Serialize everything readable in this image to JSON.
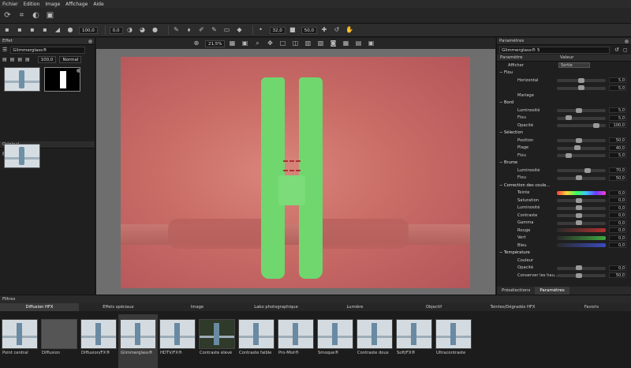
{
  "menu": [
    "Fichier",
    "Edition",
    "Image",
    "Affichage",
    "Aide"
  ],
  "toolbar2": {
    "value_1": "100,0",
    "value_2": "0,0",
    "value_3": "32,0",
    "value_4": "50,0"
  },
  "canvas": {
    "zoom": "21,5"
  },
  "effects_panel": {
    "title": "Effet",
    "preset_name": "Glimmerglass®",
    "opacity_value": "100,0",
    "mode_label": "Normal",
    "original_title": "Original"
  },
  "params_panel": {
    "title": "Paramètres",
    "preset_name": "Glimmerglass® 5",
    "col_param": "Paramètre",
    "col_value": "Valeur",
    "afficher_label": "Afficher",
    "afficher_value": "Sortie",
    "rows": [
      {
        "kind": "section",
        "label": "Flou"
      },
      {
        "kind": "item",
        "label": "Horizontal",
        "value": "5,0",
        "knob": 0.5
      },
      {
        "kind": "item",
        "label": "",
        "value": "5,0",
        "knob": 0.5
      },
      {
        "kind": "item",
        "label": "Mariage",
        "value": "",
        "knob": -1
      },
      {
        "kind": "section",
        "label": "Bord"
      },
      {
        "kind": "item",
        "label": "Luminosité",
        "value": "5,0",
        "knob": 0.45
      },
      {
        "kind": "item",
        "label": "Flou",
        "value": "5,0",
        "knob": 0.2
      },
      {
        "kind": "item",
        "label": "Opacité",
        "value": "100,0",
        "knob": 0.85
      },
      {
        "kind": "section",
        "label": "Sélection"
      },
      {
        "kind": "item",
        "label": "Position",
        "value": "50,0",
        "knob": 0.45
      },
      {
        "kind": "item",
        "label": "Plage",
        "value": "40,0",
        "knob": 0.4
      },
      {
        "kind": "item",
        "label": "Flou",
        "value": "5,0",
        "knob": 0.2
      },
      {
        "kind": "section",
        "label": "Brume"
      },
      {
        "kind": "item",
        "label": "Luminosité",
        "value": "70,0",
        "knob": 0.65
      },
      {
        "kind": "item",
        "label": "Flou",
        "value": "50,0",
        "knob": 0.45
      },
      {
        "kind": "section",
        "label": "Correction des coule..."
      },
      {
        "kind": "grad",
        "label": "Teinte",
        "value": "0,0",
        "colors": "linear-gradient(90deg,#ff3b3b,#ffd33b,#3bff5a,#3bc7ff,#6a3bff,#ff3bd0)"
      },
      {
        "kind": "item",
        "label": "Saturation",
        "value": "0,0",
        "knob": 0.45
      },
      {
        "kind": "item",
        "label": "Luminosité",
        "value": "0,0",
        "knob": 0.45
      },
      {
        "kind": "item",
        "label": "Contraste",
        "value": "0,0",
        "knob": 0.45
      },
      {
        "kind": "item",
        "label": "Gamma",
        "value": "0,0",
        "knob": 0.45
      },
      {
        "kind": "grad",
        "label": "Rouge",
        "value": "0,0",
        "colors": "linear-gradient(90deg,#2a2a2a,#b33030)"
      },
      {
        "kind": "grad",
        "label": "Vert",
        "value": "0,0",
        "colors": "linear-gradient(90deg,#2a2a2a,#3fa83f)"
      },
      {
        "kind": "grad",
        "label": "Bleu",
        "value": "0,0",
        "colors": "linear-gradient(90deg,#2a2a2a,#3a4bc0)"
      },
      {
        "kind": "section",
        "label": "Température"
      },
      {
        "kind": "item",
        "label": "Couleur",
        "value": "",
        "knob": -1
      },
      {
        "kind": "item",
        "label": "Opacité",
        "value": "0,0",
        "knob": 0.45
      },
      {
        "kind": "item",
        "label": "Conserver les hau...",
        "value": "50,0",
        "knob": 0.45
      }
    ],
    "tab_presets": "Présélections",
    "tab_params": "Paramètres"
  },
  "filters": {
    "title": "Filtres",
    "categories": [
      "Diffusion HFX",
      "Effets spéciaux",
      "Image",
      "Labo photographique",
      "Lumière",
      "Objectif",
      "Teintes/Dégradés HFX",
      "Favoris"
    ],
    "items": [
      "Point central",
      "Diffusion",
      "Diffusion/FX®",
      "Glimmerglass®",
      "HDTV/FX®",
      "Contraste élevé",
      "Contraste faible",
      "Pro-Mist®",
      "Smoque®",
      "Contraste doux",
      "Soft/FX®",
      "Ultracontraste"
    ]
  }
}
